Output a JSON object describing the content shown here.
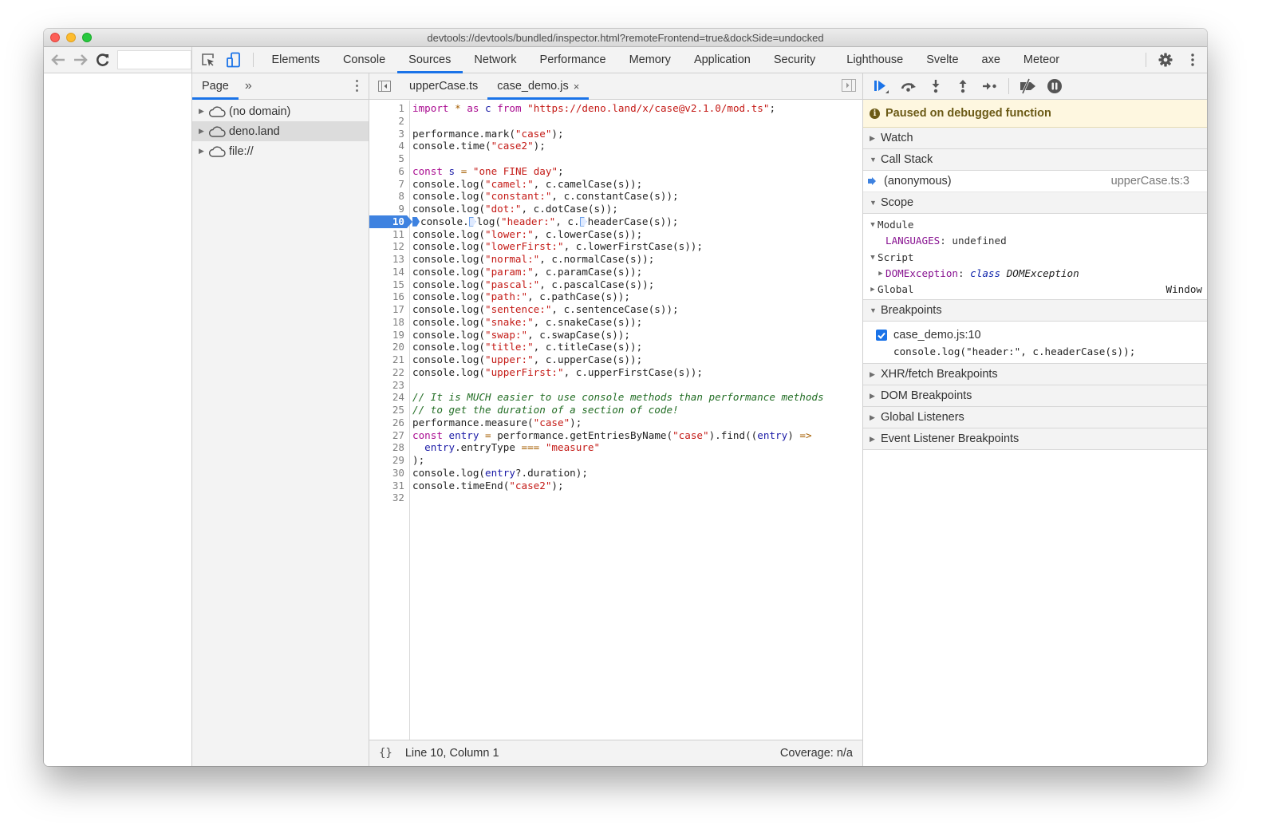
{
  "window": {
    "title": "devtools://devtools/bundled/inspector.html?remoteFrontend=true&dockSide=undocked"
  },
  "browser": {
    "back_icon": "arrow-left-icon",
    "forward_icon": "arrow-right-icon",
    "reload_icon": "reload-icon",
    "url_value": ""
  },
  "main_tabs": [
    {
      "label": "Elements",
      "active": false
    },
    {
      "label": "Console",
      "active": false
    },
    {
      "label": "Sources",
      "active": true
    },
    {
      "label": "Network",
      "active": false
    },
    {
      "label": "Performance",
      "active": false
    },
    {
      "label": "Memory",
      "active": false
    },
    {
      "label": "Application",
      "active": false
    },
    {
      "label": "Security",
      "active": false
    },
    {
      "label": "Lighthouse",
      "active": false
    },
    {
      "label": "Svelte",
      "active": false
    },
    {
      "label": "axe",
      "active": false
    },
    {
      "label": "Meteor",
      "active": false
    }
  ],
  "navigator": {
    "tab_label": "Page",
    "more_label": "»",
    "items": [
      {
        "label": "(no domain)",
        "selected": false
      },
      {
        "label": "deno.land",
        "selected": true
      },
      {
        "label": "file://",
        "selected": false
      }
    ]
  },
  "editor": {
    "tabs": [
      {
        "label": "upperCase.ts",
        "active": false,
        "closable": false
      },
      {
        "label": "case_demo.js",
        "active": true,
        "closable": true,
        "close_label": "×"
      }
    ],
    "execution_line": 10,
    "lines": [
      "import * as c from \"https://deno.land/x/case@v2.1.0/mod.ts\";",
      "",
      "performance.mark(\"case\");",
      "console.time(\"case2\");",
      "",
      "const s = \"one FINE day\";",
      "console.log(\"camel:\", c.camelCase(s));",
      "console.log(\"constant:\", c.constantCase(s));",
      "console.log(\"dot:\", c.dotCase(s));",
      "console.log(\"header:\", c.headerCase(s));",
      "console.log(\"lower:\", c.lowerCase(s));",
      "console.log(\"lowerFirst:\", c.lowerFirstCase(s));",
      "console.log(\"normal:\", c.normalCase(s));",
      "console.log(\"param:\", c.paramCase(s));",
      "console.log(\"pascal:\", c.pascalCase(s));",
      "console.log(\"path:\", c.pathCase(s));",
      "console.log(\"sentence:\", c.sentenceCase(s));",
      "console.log(\"snake:\", c.snakeCase(s));",
      "console.log(\"swap:\", c.swapCase(s));",
      "console.log(\"title:\", c.titleCase(s));",
      "console.log(\"upper:\", c.upperCase(s));",
      "console.log(\"upperFirst:\", c.upperFirstCase(s));",
      "",
      "// It is MUCH easier to use console methods than performance methods",
      "// to get the duration of a section of code!",
      "performance.measure(\"case\");",
      "const entry = performance.getEntriesByName(\"case\").find((entry) =>",
      "  entry.entryType === \"measure\"",
      ");",
      "console.log(entry?.duration);",
      "console.timeEnd(\"case2\");",
      ""
    ],
    "status": {
      "format_label": "{}",
      "position": "Line 10, Column 1",
      "coverage": "Coverage: n/a"
    }
  },
  "debugger": {
    "paused_message": "Paused on debugged function",
    "sections": {
      "watch": "Watch",
      "call_stack": "Call Stack",
      "scope": "Scope",
      "breakpoints": "Breakpoints",
      "xhr": "XHR/fetch Breakpoints",
      "dom": "DOM Breakpoints",
      "global_listeners": "Global Listeners",
      "event_listeners": "Event Listener Breakpoints"
    },
    "call_stack": [
      {
        "name": "(anonymous)",
        "location": "upperCase.ts:3",
        "current": true
      }
    ],
    "scope": {
      "module": {
        "label": "Module",
        "props": [
          {
            "name": "LANGUAGES",
            "value": "undefined"
          }
        ]
      },
      "script": {
        "label": "Script",
        "props": [
          {
            "name": "DOMException",
            "keyword": "class",
            "value": "DOMException"
          }
        ]
      },
      "global": {
        "label": "Global",
        "value": "Window"
      }
    },
    "breakpoints": [
      {
        "location": "case_demo.js:10",
        "code": "console.log(\"header:\", c.headerCase(s));",
        "enabled": true
      }
    ]
  },
  "colors": {
    "accent": "#1a73e8",
    "execution_line": "#3e82e0",
    "paused_banner_bg": "#fef7e0",
    "paused_banner_text": "#6b5a16"
  }
}
